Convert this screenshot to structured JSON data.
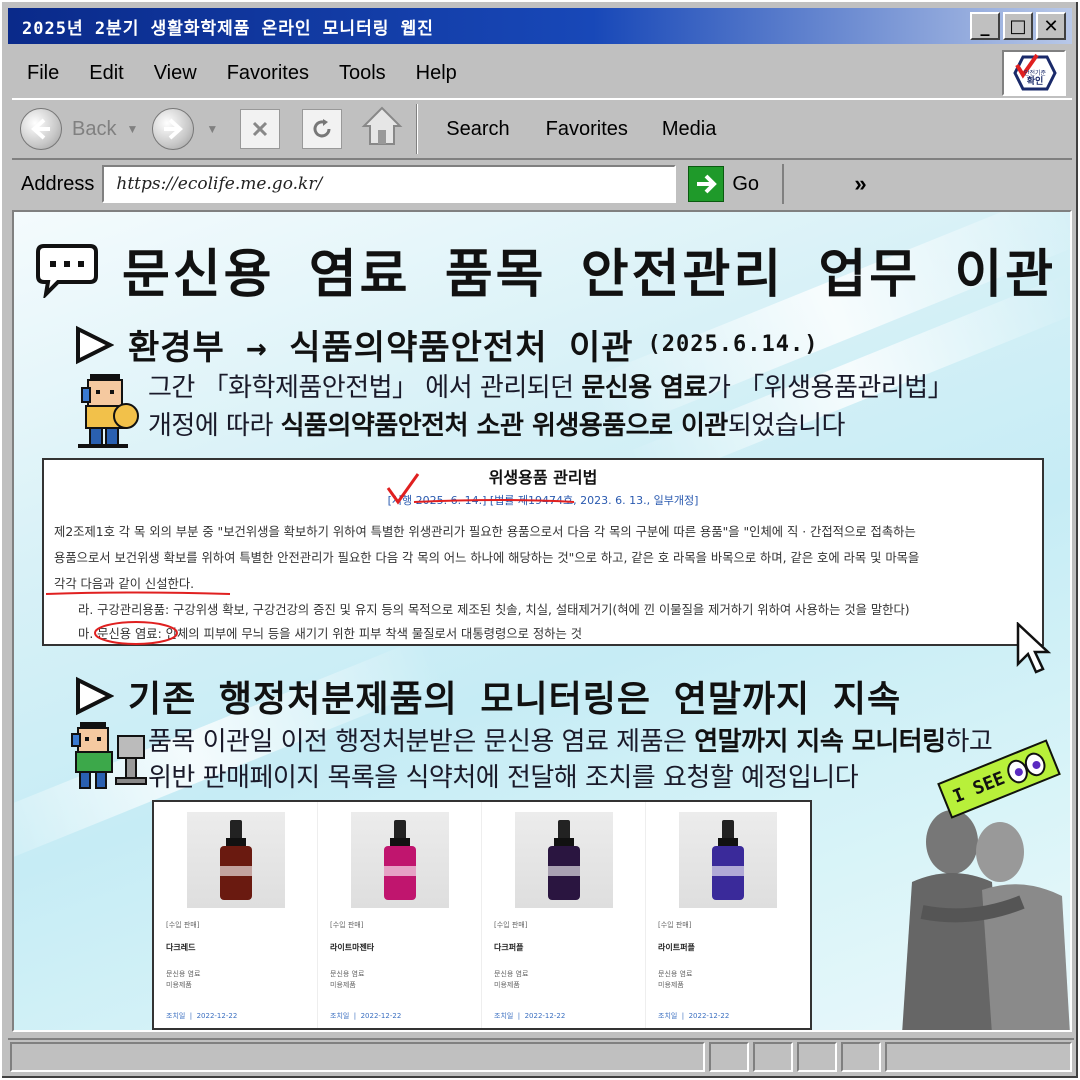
{
  "window": {
    "title": "2025년 2분기 생활화학제품 온라인 모니터링 웹진",
    "minimize": "_",
    "maximize": "□",
    "close": "✕"
  },
  "menu": [
    "File",
    "Edit",
    "View",
    "Favorites",
    "Tools",
    "Help"
  ],
  "logo_text": "안전기준\n확인",
  "toolbar": {
    "back": "Back",
    "search": "Search",
    "favorites": "Favorites",
    "media": "Media"
  },
  "address": {
    "label": "Address",
    "url": "https://ecolife.me.go.kr/",
    "go": "Go",
    "more": "»"
  },
  "content": {
    "heading": "문신용 염료 품목 안전관리 업무 이관",
    "section1": {
      "title": "환경부 → 식품의약품안전처 이관",
      "date": "(2025.6.14.)",
      "p1_a": "그간 「화학제품안전법」 에서 관리되던 ",
      "p1_b": "문신용 염료",
      "p1_c": "가 「위생용품관리법」",
      "p2_a": "개정에 따라 ",
      "p2_b": "식품의약품안전처 소관 위생용품으로 이관",
      "p2_c": "되었습니다"
    },
    "law": {
      "title": "위생용품 관리법",
      "subtitle": "[시행 2025. 6. 14.] [법률 제19474호, 2023. 6. 13., 일부개정]",
      "line1": "제2조제1호 각 목 외의 부분 중 \"보건위생을 확보하기 위하여 특별한 위생관리가 필요한 용품으로서 다음 각 목의 구분에 따른 용품\"을 \"인체에 직 · 간접적으로 접촉하는",
      "line2": "용품으로서 보건위생 확보를 위하여 특별한 안전관리가 필요한 다음 각 목의 어느 하나에 해당하는 것\"으로 하고, 같은 호 라목을 바목으로 하며, 같은 호에 라목 및 마목을",
      "line3": "각각 다음과 같이 신설한다.",
      "line4": "라. 구강관리용품: 구강위생 확보, 구강건강의 증진 및 유지 등의 목적으로 제조된 칫솔, 치실, 설태제거기(혀에 낀 이물질을 제거하기 위하여 사용하는 것을 말한다)",
      "line5_a": "마. ",
      "line5_b": "문신용 염료",
      "line5_c": ": 인체의 피부에 무늬 등을 새기기 위한 피부 착색 물질로서 대통령령으로 정하는 것"
    },
    "section2": {
      "title": "기존 행정처분제품의 모니터링은 연말까지 지속",
      "p1_a": "품목 이관일 이전 행정처분받은 문신용 염료 제품은 ",
      "p1_b": "연말까지 지속 모니터링",
      "p1_c": "하고",
      "p2": "위반 판매페이지 목록을 식약처에 전달해 조치를 요청할 예정입니다"
    },
    "badge": "I SEE",
    "products": [
      {
        "tag": "[수입 판매]",
        "name": "다크레드",
        "cat1": "문신용 염료",
        "cat2": "미용제품",
        "status": "조치일",
        "date": "2022-12-22",
        "color": "#6a1a10"
      },
      {
        "tag": "[수입 판매]",
        "name": "라이트마젠타",
        "cat1": "문신용 염료",
        "cat2": "미용제품",
        "status": "조치일",
        "date": "2022-12-22",
        "color": "#c0156e"
      },
      {
        "tag": "[수입 판매]",
        "name": "다크퍼플",
        "cat1": "문신용 염료",
        "cat2": "미용제품",
        "status": "조치일",
        "date": "2022-12-22",
        "color": "#2a1540"
      },
      {
        "tag": "[수입 판매]",
        "name": "라이트퍼플",
        "cat1": "문신용 염료",
        "cat2": "미용제품",
        "status": "조치일",
        "date": "2022-12-22",
        "color": "#3a2a9a"
      }
    ]
  },
  "colors": {
    "titlebar": "#0a2a8a",
    "chrome": "#c0c0c0",
    "content_bg": "#c6ecf5",
    "accent_red": "#e02020",
    "link_blue": "#2a5ab0"
  }
}
